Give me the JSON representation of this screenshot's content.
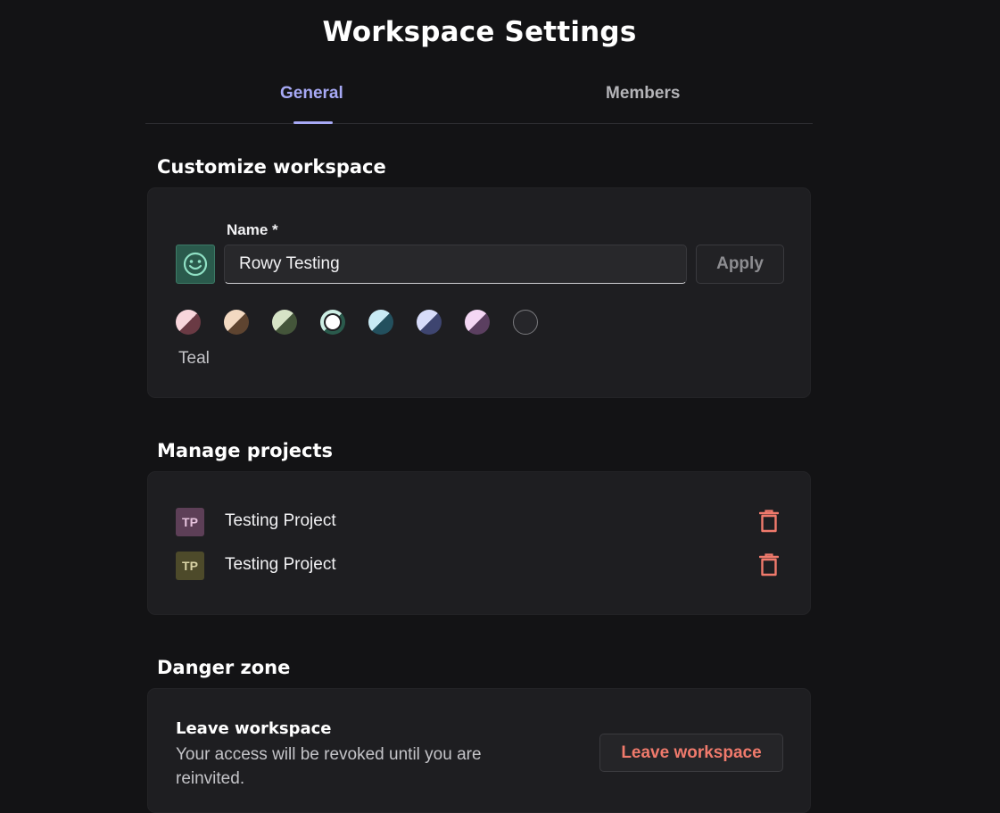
{
  "page": {
    "title": "Workspace Settings"
  },
  "tabs": [
    {
      "label": "General",
      "active": true
    },
    {
      "label": "Members",
      "active": false
    }
  ],
  "customize": {
    "section_title": "Customize workspace",
    "name_label": "Name *",
    "name_value": "Rowy Testing",
    "apply_label": "Apply",
    "avatar_icon": "smiley-face-icon",
    "selected_color_name": "Teal",
    "swatches": [
      {
        "name": "pink",
        "light": "#f8d6dc",
        "dark": "#6a3a44"
      },
      {
        "name": "orange",
        "light": "#f2d9c2",
        "dark": "#5e4430"
      },
      {
        "name": "green",
        "light": "#d6e3c6",
        "dark": "#44553a"
      },
      {
        "name": "teal",
        "light": "#cdeee4",
        "dark": "#2a5a4c",
        "selected": true
      },
      {
        "name": "cyan",
        "light": "#c8eaf4",
        "dark": "#23505e"
      },
      {
        "name": "blue",
        "light": "#d7dcfa",
        "dark": "#3e4570"
      },
      {
        "name": "purple",
        "light": "#f4d7f4",
        "dark": "#5b3f60"
      },
      {
        "name": "none"
      }
    ]
  },
  "projects": {
    "section_title": "Manage projects",
    "items": [
      {
        "initials": "TP",
        "name": "Testing Project",
        "badge_bg": "#5d3f57",
        "badge_fg": "#e6c3dd"
      },
      {
        "initials": "TP",
        "name": "Testing Project",
        "badge_bg": "#4d4a2a",
        "badge_fg": "#d9d3a6"
      }
    ],
    "delete_icon": "trash-icon"
  },
  "danger": {
    "section_title": "Danger zone",
    "leave_title": "Leave workspace",
    "leave_desc": "Your access will be revoked until you are reinvited.",
    "leave_button": "Leave workspace"
  },
  "colors": {
    "accent": "#a7a9f5",
    "danger": "#f07a6c",
    "background": "#131315",
    "card": "#1e1e21"
  }
}
